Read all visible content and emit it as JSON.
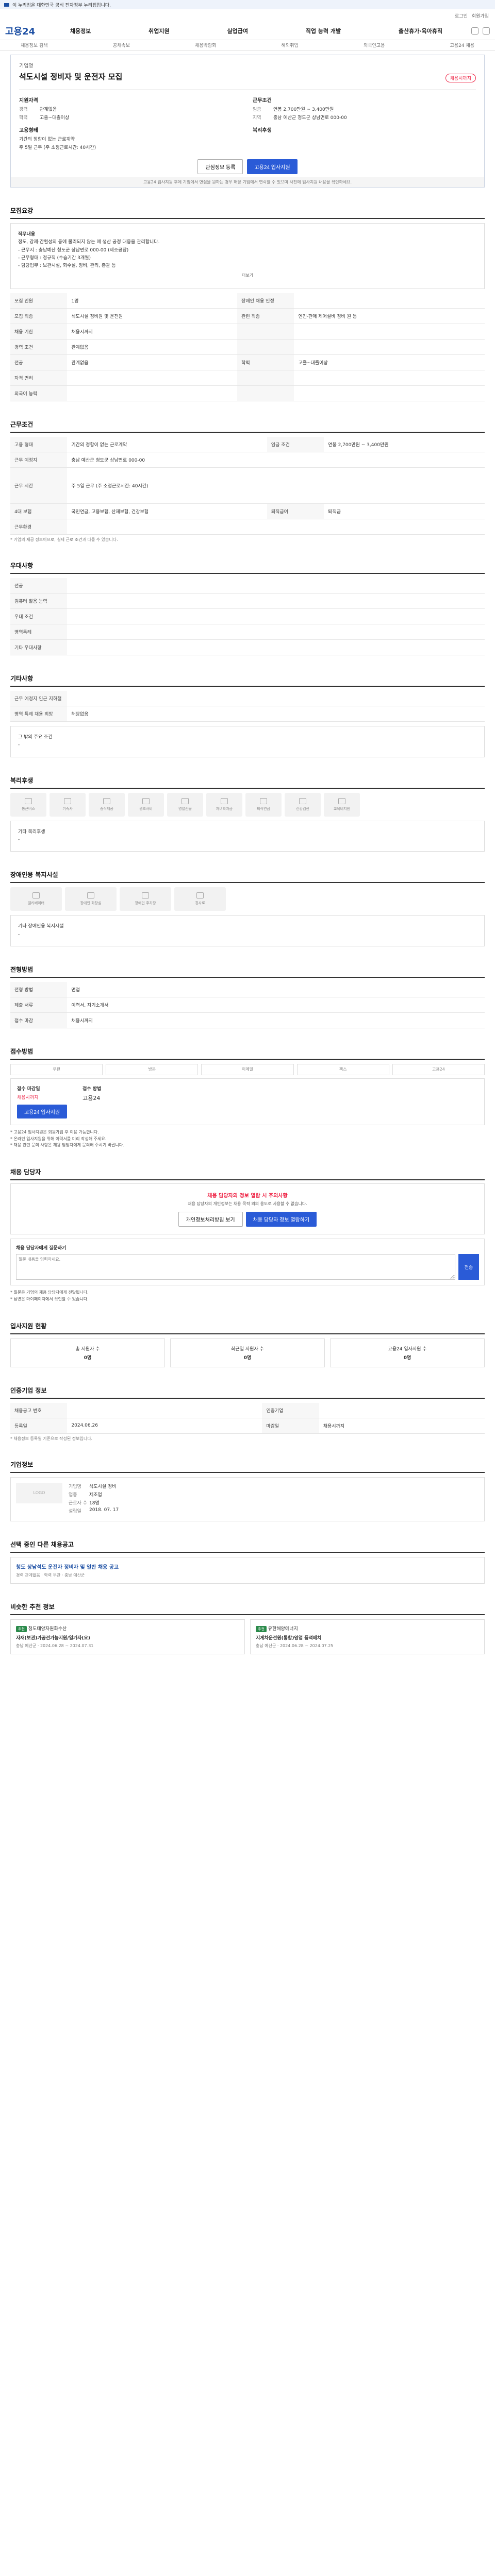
{
  "topbar": {
    "text": "이 누리집은 대한민국 공식 전자정부 누리집입니다.",
    "verify": ""
  },
  "util": {
    "links": [
      "로그인",
      "회원가입",
      "고객센터",
      "ENG",
      "한국어"
    ]
  },
  "logo": "고용24",
  "gnb": [
    "채용정보",
    "취업지원",
    "실업급여",
    "직업 능력 개발",
    "출산휴가·육아휴직"
  ],
  "subnav": [
    "채용정보 검색",
    "공채속보",
    "채용박람회",
    "해외취업",
    "외국인고용",
    "고용24 채용"
  ],
  "job": {
    "company": "기업명",
    "title": "석도시설 정비자 및 운전자 모집",
    "badge": "채용시까지",
    "qual_title": "지원자격",
    "qual": [
      {
        "k": "경력",
        "v": "관계없음"
      },
      {
        "k": "학력",
        "v": "고졸~대졸이상"
      }
    ],
    "cond_title": "근무조건",
    "cond": [
      {
        "k": "임금",
        "v": "연봉 2,700만원 ~ 3,400만원"
      },
      {
        "k": "지역",
        "v": "충남 예산군 청도군 상남면로 000-00"
      }
    ],
    "type_title": "고용형태",
    "type": [
      {
        "k": "",
        "v": "기간의 정함이 없는 근로계약"
      },
      {
        "k": "",
        "v": "주 5일 근무 (주 소정근로시간: 40시간)"
      }
    ],
    "welfare_title": "복리후생",
    "btn_interest": "관심정보 등록",
    "btn_apply": "고용24 입사지원",
    "notice": "고용24 입사지원 후에 기업에서 면접을 원하는 경우 해당 기업에서 연락할 수 있으며 사전에 입사지원 내용을 확인하세요."
  },
  "sections": {
    "recruit": "모집요강",
    "work": "근무조건",
    "prefer": "우대사항",
    "etc": "기타사항",
    "welfare": "복리후생",
    "disabled": "장애인용 복지시설",
    "screen": "전형방법",
    "apply": "접수방법",
    "contact": "채용 담당자",
    "status": "입사지원 현황",
    "info": "인증기업 정보",
    "company": "기업정보",
    "other": "선택 중인 다른 채용공고",
    "similar": "비슷한 추천 정보"
  },
  "recruit": {
    "desc_title": "직무내용",
    "desc": [
      "정도, 강제·간헐성의 등에 물리되지 않는 매 생산 공정 대응을 관리합니다.",
      "- 근무지 : 충남예산 청도군 상남면로 000-00 (제조공장)",
      "- 근무형태 : 정규직 (수습기간 3개월)",
      "- 담당업무 : 보관시설, 회수설, 정비, 관리, 총괄 등"
    ],
    "more": "더보기",
    "rows": [
      {
        "h1": "모집 인원",
        "v1": "1명",
        "h2": "장애인 채용 인정",
        "v2": ""
      },
      {
        "h1": "모집 직종",
        "v1": "석도시설 정비원 및 운전원",
        "h2": "관련 직종",
        "v2": "엔진·판매 제어설비 정비 원 등"
      },
      {
        "h1": "채용 기한",
        "v1": "채용시까지",
        "h2": "",
        "v2": ""
      },
      {
        "h1": "경력 조건",
        "v1": "관계없음",
        "h2": "",
        "v2": ""
      },
      {
        "h1": "전공",
        "v1": "관계없음",
        "h2": "학력",
        "v2": "고졸~대졸이상"
      },
      {
        "h1": "자격 면허",
        "v1": "",
        "h2": "",
        "v2": ""
      },
      {
        "h1": "외국어 능력",
        "v1": "",
        "h2": "",
        "v2": ""
      }
    ]
  },
  "work": {
    "rows": [
      {
        "h1": "고용 형태",
        "v1": "기간의 정함이 없는 근로계약",
        "h2": "임금 조건",
        "v2": "연봉 2,700만원 ~ 3,400만원"
      },
      {
        "h1": "근무 예정지",
        "v1": "충남 예산군 청도군 상남면로 000-00",
        "h2": "",
        "v2": ""
      },
      {
        "h1": "근무 시간",
        "v1": "주 5일 근무 (주 소정근로시간: 40시간)",
        "h2": "",
        "v2": ""
      },
      {
        "h1": "4대 보험",
        "v1": "국민연금, 고용보험, 산재보험, 건강보험",
        "h2": "퇴직급여",
        "v2": "퇴직금"
      },
      {
        "h1": "근무환경",
        "v1": "",
        "h2": "",
        "v2": ""
      }
    ],
    "note": "* 기업의 제공 정보이므로, 실제 근로 조건과 다를 수 있습니다."
  },
  "prefer": {
    "rows": [
      {
        "h": "전공",
        "v": ""
      },
      {
        "h": "컴퓨터 활용 능력",
        "v": ""
      },
      {
        "h": "우대 조건",
        "v": ""
      },
      {
        "h": "병역특례",
        "v": ""
      },
      {
        "h": "기타 우대사항",
        "v": ""
      }
    ]
  },
  "etc": {
    "rows": [
      {
        "h": "근무 예정지 인근 지하철",
        "v": ""
      },
      {
        "h": "병역 특례 채용 희망",
        "v": "해당없음"
      }
    ],
    "note_title": "그 밖의 주요 조건",
    "note": "-"
  },
  "welfare": {
    "items": [
      "통근버스",
      "기숙사",
      "중식제공",
      "경조사비",
      "명절선물",
      "자녀학자금",
      "퇴직연금",
      "건강검진",
      "교육비지원"
    ],
    "extra_title": "기타 복리후생",
    "extra": "-"
  },
  "disabled": {
    "items": [
      "엘리베이터",
      "장애인 화장실",
      "장애인 주차장",
      "경사로"
    ],
    "extra_title": "기타 장애인용 복지시설",
    "extra": "-"
  },
  "screen": {
    "rows": [
      {
        "h": "전형 방법",
        "v": "면접"
      },
      {
        "h": "제출 서류",
        "v": "이력서, 자기소개서"
      },
      {
        "h": "접수 마감",
        "v": "채용시까지"
      }
    ]
  },
  "apply": {
    "methods": [
      "우편",
      "방문",
      "이메일",
      "팩스",
      "고용24"
    ],
    "col1_title": "접수 마감일",
    "col1_val": "채용시까지",
    "col2_title": "접수 방법",
    "col2_val": "고용24",
    "btn": "고용24 입사지원",
    "notes": [
      "* 고용24 입사지원은 회원가입 후 이용 가능합니다.",
      "* 온라인 입사지원을 위해 이력서를 미리 작성해 주세요.",
      "* 채용 관련 문의 사항은 채용 담당자에게 문의해 주시기 바랍니다."
    ]
  },
  "contact": {
    "warn_title": "채용 담당자의 정보 열람 시 주의사항",
    "warn_text": "채용 담당자의 개인정보는 채용 목적 외의 용도로 사용할 수 없습니다.",
    "btn1": "개인정보처리방침 보기",
    "btn2": "채용 담당자 정보 열람하기",
    "inquiry_title": "채용 담당자에게 질문하기",
    "inquiry_placeholder": "질문 내용을 입력하세요.",
    "send": "전송",
    "notes": [
      "* 질문은 기업의 채용 담당자에게 전달됩니다.",
      "* 답변은 마이페이지에서 확인할 수 있습니다."
    ]
  },
  "status": {
    "cards": [
      {
        "label": "총 지원자 수",
        "num": "0명"
      },
      {
        "label": "최근일 지원자 수",
        "num": "0명"
      },
      {
        "label": "고용24 입사지원 수",
        "num": "0명"
      }
    ]
  },
  "info": {
    "rows": [
      {
        "h1": "채용공고 번호",
        "v1": "",
        "h2": "인증기업",
        "v2": ""
      },
      {
        "h1": "등록일",
        "v1": "2024.06.26",
        "h2": "마감일",
        "v2": "채용시까지"
      }
    ],
    "note": "* 채용정보 등록일 기준으로 작성된 정보입니다."
  },
  "company": {
    "logo": "LOGO",
    "rows": [
      {
        "k": "기업명",
        "v": "석도시설 정비"
      },
      {
        "k": "업종",
        "v": "제조업"
      },
      {
        "k": "근로자 수",
        "v": "18명"
      },
      {
        "k": "설립일",
        "v": "2018. 07. 17"
      }
    ]
  },
  "other": {
    "title": "청도 상남석도 운전자 정비자 및 일반 채용 공고",
    "meta": "경력 관계없음 · 학력 무관 · 충남 예산군"
  },
  "similar": {
    "cards": [
      {
        "tag": "추천",
        "company": "청도태양자원화수산",
        "title": "자재(보관)가공전가능지원/일가자(요)",
        "meta": "충남 예산군 · 2024.06.28 ~ 2024.07.31"
      },
      {
        "tag": "추천",
        "company": "유한해양에너지",
        "title": "지게차운전원(통합)영업 품석배치",
        "meta": "충남 예산군 · 2024.06.28 ~ 2024.07.25"
      }
    ]
  }
}
